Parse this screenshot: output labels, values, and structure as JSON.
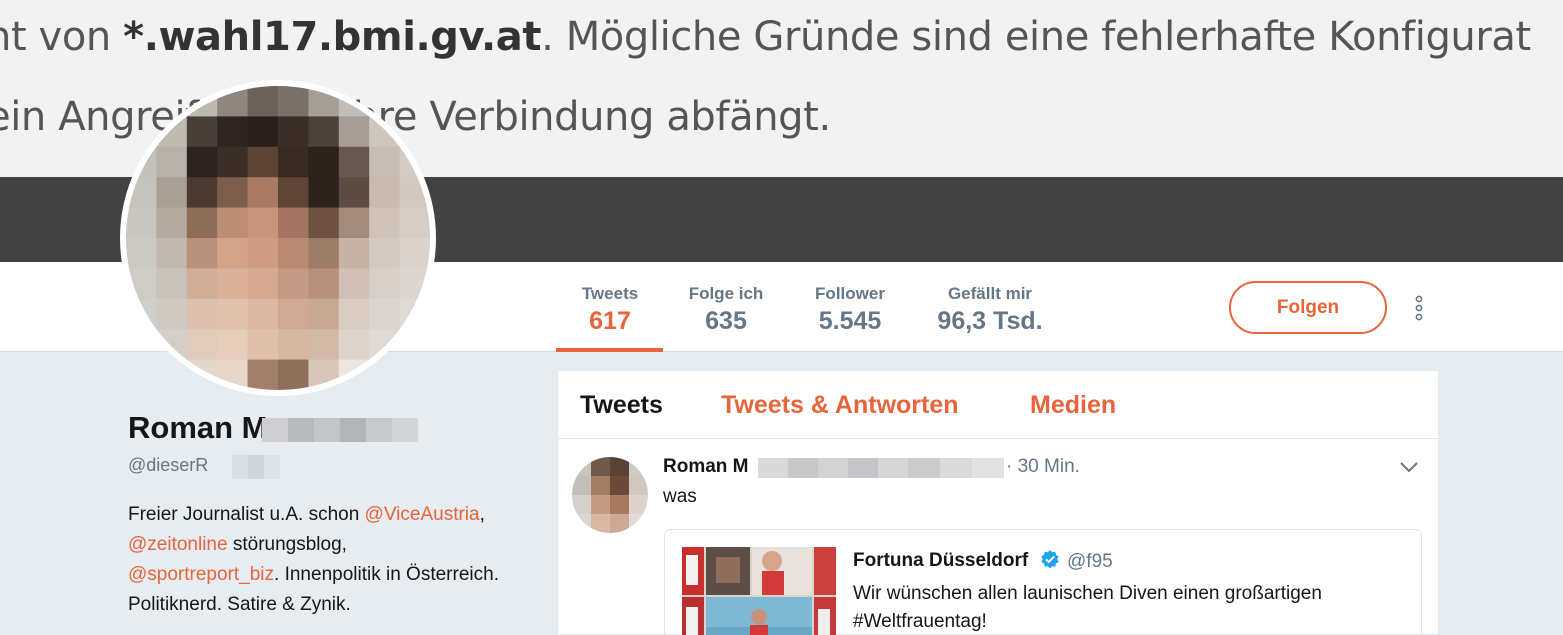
{
  "banner": {
    "line1_prefix": "nt von ",
    "line1_host": "*.wahl17.bmi.gv.at",
    "line1_suffix": ". Mögliche Gründe sind eine fehlerhafte Konfigurat",
    "line2": "ein Angreifer, der Ihre Verbindung abfängt."
  },
  "profile_nav": {
    "stats": [
      {
        "label": "Tweets",
        "value": "617"
      },
      {
        "label": "Folge ich",
        "value": "635"
      },
      {
        "label": "Follower",
        "value": "5.545"
      },
      {
        "label": "Gefällt mir",
        "value": "96,3 Tsd."
      }
    ],
    "follow_label": "Folgen"
  },
  "profile": {
    "name": "Roman M",
    "handle": "@dieserR",
    "bio": {
      "t1": "Freier Journalist u.A. schon ",
      "m1": "@ViceAustria",
      "t2": ", ",
      "m2": "@zeitonline",
      "t3": " störungsblog, ",
      "m3": "@sportreport_biz",
      "t4": ". Innenpolitik in Österreich. Politiknerd. Satire & Zynik."
    }
  },
  "timeline": {
    "tabs": [
      "Tweets",
      "Tweets & Antworten",
      "Medien"
    ],
    "tweet": {
      "name": "Roman M",
      "time": "· 30 Min.",
      "text": "was",
      "quote": {
        "name": "Fortuna Düsseldorf",
        "handle": "@f95",
        "text": "Wir wünschen allen launischen Diven einen großartigen #Weltfrauentag!"
      }
    }
  },
  "colors": {
    "accent": "#e8643a",
    "secondary_text": "#657786",
    "background": "#e6ecf0",
    "banner_dark": "#424242"
  }
}
